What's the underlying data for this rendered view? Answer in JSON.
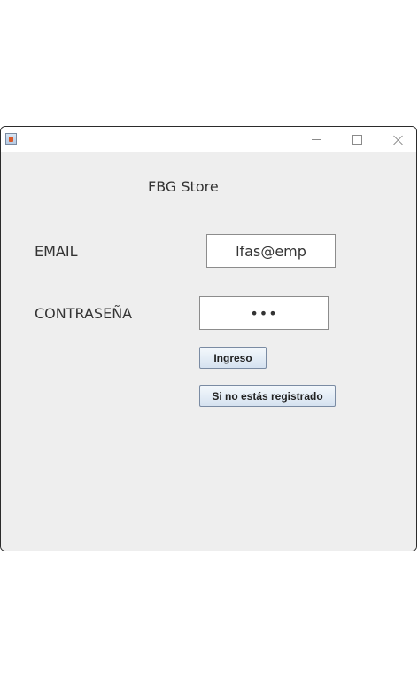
{
  "window": {
    "title": "",
    "controls": {
      "minimize_icon": "minimize-icon",
      "maximize_icon": "maximize-icon",
      "close_icon": "close-icon"
    }
  },
  "form": {
    "store_title": "FBG Store",
    "email_label": "EMAIL",
    "email_value": "lfas@emp",
    "password_label": "CONTRASEÑA",
    "password_value": "•••",
    "login_button": "Ingreso",
    "register_button": "Si no estás registrado"
  },
  "colors": {
    "background": "#eeeeee",
    "button_gradient_top": "#f4f8fc",
    "button_gradient_bottom": "#d5e2f0",
    "button_border": "#7a8ba3"
  }
}
